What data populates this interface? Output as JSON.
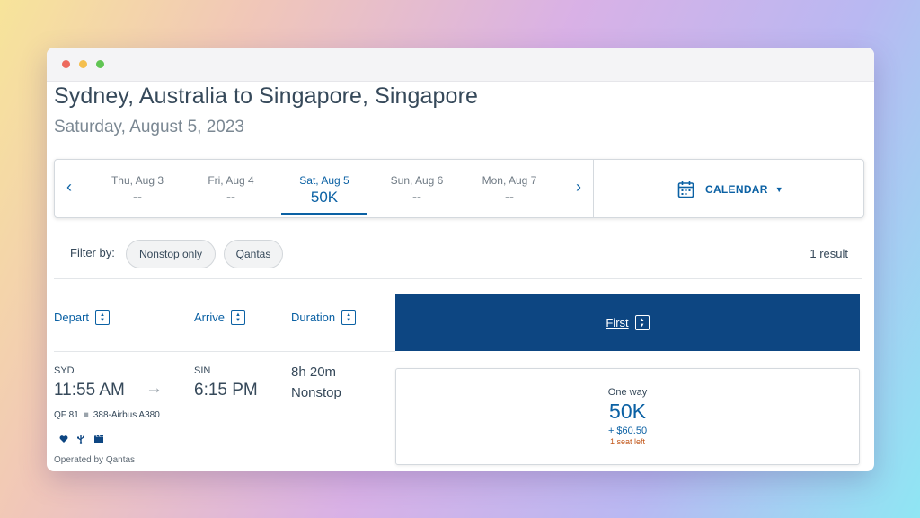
{
  "header": {
    "route_title": "Sydney, Australia to Singapore, Singapore",
    "travel_date": "Saturday, August 5, 2023"
  },
  "date_bar": {
    "prev_icon": "chevron-left-icon",
    "next_icon": "chevron-right-icon",
    "days": [
      {
        "label": "Thu, Aug 3",
        "price": "--",
        "selected": false
      },
      {
        "label": "Fri, Aug 4",
        "price": "--",
        "selected": false
      },
      {
        "label": "Sat, Aug 5",
        "price": "50K",
        "selected": true
      },
      {
        "label": "Sun, Aug 6",
        "price": "--",
        "selected": false
      },
      {
        "label": "Mon, Aug 7",
        "price": "--",
        "selected": false
      }
    ],
    "calendar_label": "CALENDAR"
  },
  "filters": {
    "label": "Filter by:",
    "options": [
      "Nonstop only",
      "Qantas"
    ],
    "result_count": "1 result"
  },
  "columns": {
    "depart": "Depart",
    "arrive": "Arrive",
    "duration": "Duration",
    "cabin": "First"
  },
  "flight": {
    "origin_code": "SYD",
    "depart_time": "11:55 AM",
    "dest_code": "SIN",
    "arrive_time": "6:15 PM",
    "duration": "8h 20m",
    "stops": "Nonstop",
    "flight_number": "QF 81",
    "aircraft": "388-Airbus A380",
    "operated_by": "Operated by Qantas",
    "amenities": [
      "heart-icon",
      "usb-icon",
      "entertainment-icon"
    ]
  },
  "fare": {
    "trip_type": "One way",
    "miles": "50K",
    "taxes": "+ $60.50",
    "seats_left": "1 seat left"
  },
  "colors": {
    "brand_blue": "#0b61a4",
    "header_navy": "#0d4682",
    "warning_orange": "#c2571a"
  }
}
